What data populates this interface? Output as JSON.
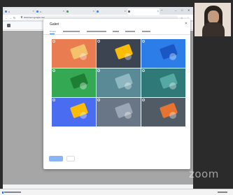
{
  "browser": {
    "tabs": [
      {
        "label": "G",
        "favicon_color": "#4285f4"
      },
      {
        "label": "G",
        "favicon_color": "#4285f4"
      },
      {
        "label": "",
        "favicon_color": "#34a853"
      },
      {
        "label": "",
        "favicon_color": "#4285f4"
      },
      {
        "label": "",
        "favicon_color": "#5f6368"
      }
    ],
    "url": "classroom.google.com"
  },
  "dialog": {
    "title": "Galeri",
    "categories": [
      "Umum",
      "",
      "",
      "",
      "",
      ""
    ],
    "active_category": 0,
    "tiles": [
      {
        "bg": "#e97c50",
        "accent": "#f6c16b"
      },
      {
        "bg": "#3c4452",
        "accent": "#fbbc04"
      },
      {
        "bg": "#2d7de8",
        "accent": "#1a56c4"
      },
      {
        "bg": "#34a853",
        "accent": "#1e7e34"
      },
      {
        "bg": "#5a8a96",
        "accent": "#8fb7c2"
      },
      {
        "bg": "#2f7a78",
        "accent": "#56a8a5"
      },
      {
        "bg": "#4a6cf0",
        "accent": "#fbbc04"
      },
      {
        "bg": "#687686",
        "accent": "#9aa6b3"
      },
      {
        "bg": "#515b66",
        "accent": "#e8732f"
      }
    ],
    "primary_button": "",
    "cancel_button": ""
  },
  "zoom_watermark": "zoom",
  "colors": {
    "accent": "#1a73e8",
    "dialog_bg": "#ffffff"
  }
}
